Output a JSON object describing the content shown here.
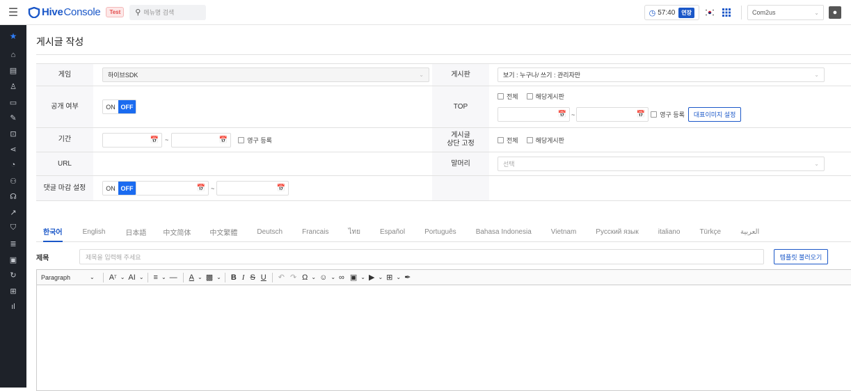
{
  "app": {
    "logo_hive": "Hive",
    "logo_console": "Console",
    "env_badge": "Test",
    "menu_search_placeholder": "메뉴명 검색",
    "timer": "57:40",
    "extend_label": "연장",
    "flag_icon": "korea-flag",
    "company": "Com2us"
  },
  "sidebar": {
    "icons": [
      "star-icon",
      "home-icon",
      "document-icon",
      "user-icon",
      "card-icon",
      "edit-doc-icon",
      "download-box-icon",
      "share-icon",
      "chat-icon",
      "group-icon",
      "headset-icon",
      "chart-line-icon",
      "shield-icon",
      "database-icon",
      "monitor-icon",
      "refresh-icon",
      "gift-icon",
      "bar-chart-icon"
    ]
  },
  "page": {
    "title": "게시글 작성"
  },
  "form": {
    "game_label": "게임",
    "game_value": "하이브SDK",
    "board_label": "게시판",
    "board_value": "보기 : 누구나/ 쓰기 : 관리자만",
    "public_label": "공개 여부",
    "on_label": "ON",
    "off_label": "OFF",
    "top_label": "TOP",
    "chk_all": "전체",
    "chk_board": "해당게시판",
    "permanent": "영구 등록",
    "rep_image_button": "대표이미지 설정",
    "period_label": "기간",
    "pin_label_line1": "게시글",
    "pin_label_line2": "상단 고정",
    "url_label": "URL",
    "prefix_label": "말머리",
    "prefix_placeholder": "선택",
    "comment_label": "댓글 마감 설정",
    "tilde": "~"
  },
  "lang_tabs": [
    "한국어",
    "English",
    "日本語",
    "中文简体",
    "中文繁體",
    "Deutsch",
    "Francais",
    "ไทย",
    "Español",
    "Português",
    "Bahasa Indonesia",
    "Vietnam",
    "Русский язык",
    "italiano",
    "Türkçe",
    "العربية"
  ],
  "subject": {
    "label": "제목",
    "placeholder": "제목을 입력해 주세요",
    "template_button": "템플릿 불러오기"
  },
  "editor": {
    "paragraph": "Paragraph"
  }
}
